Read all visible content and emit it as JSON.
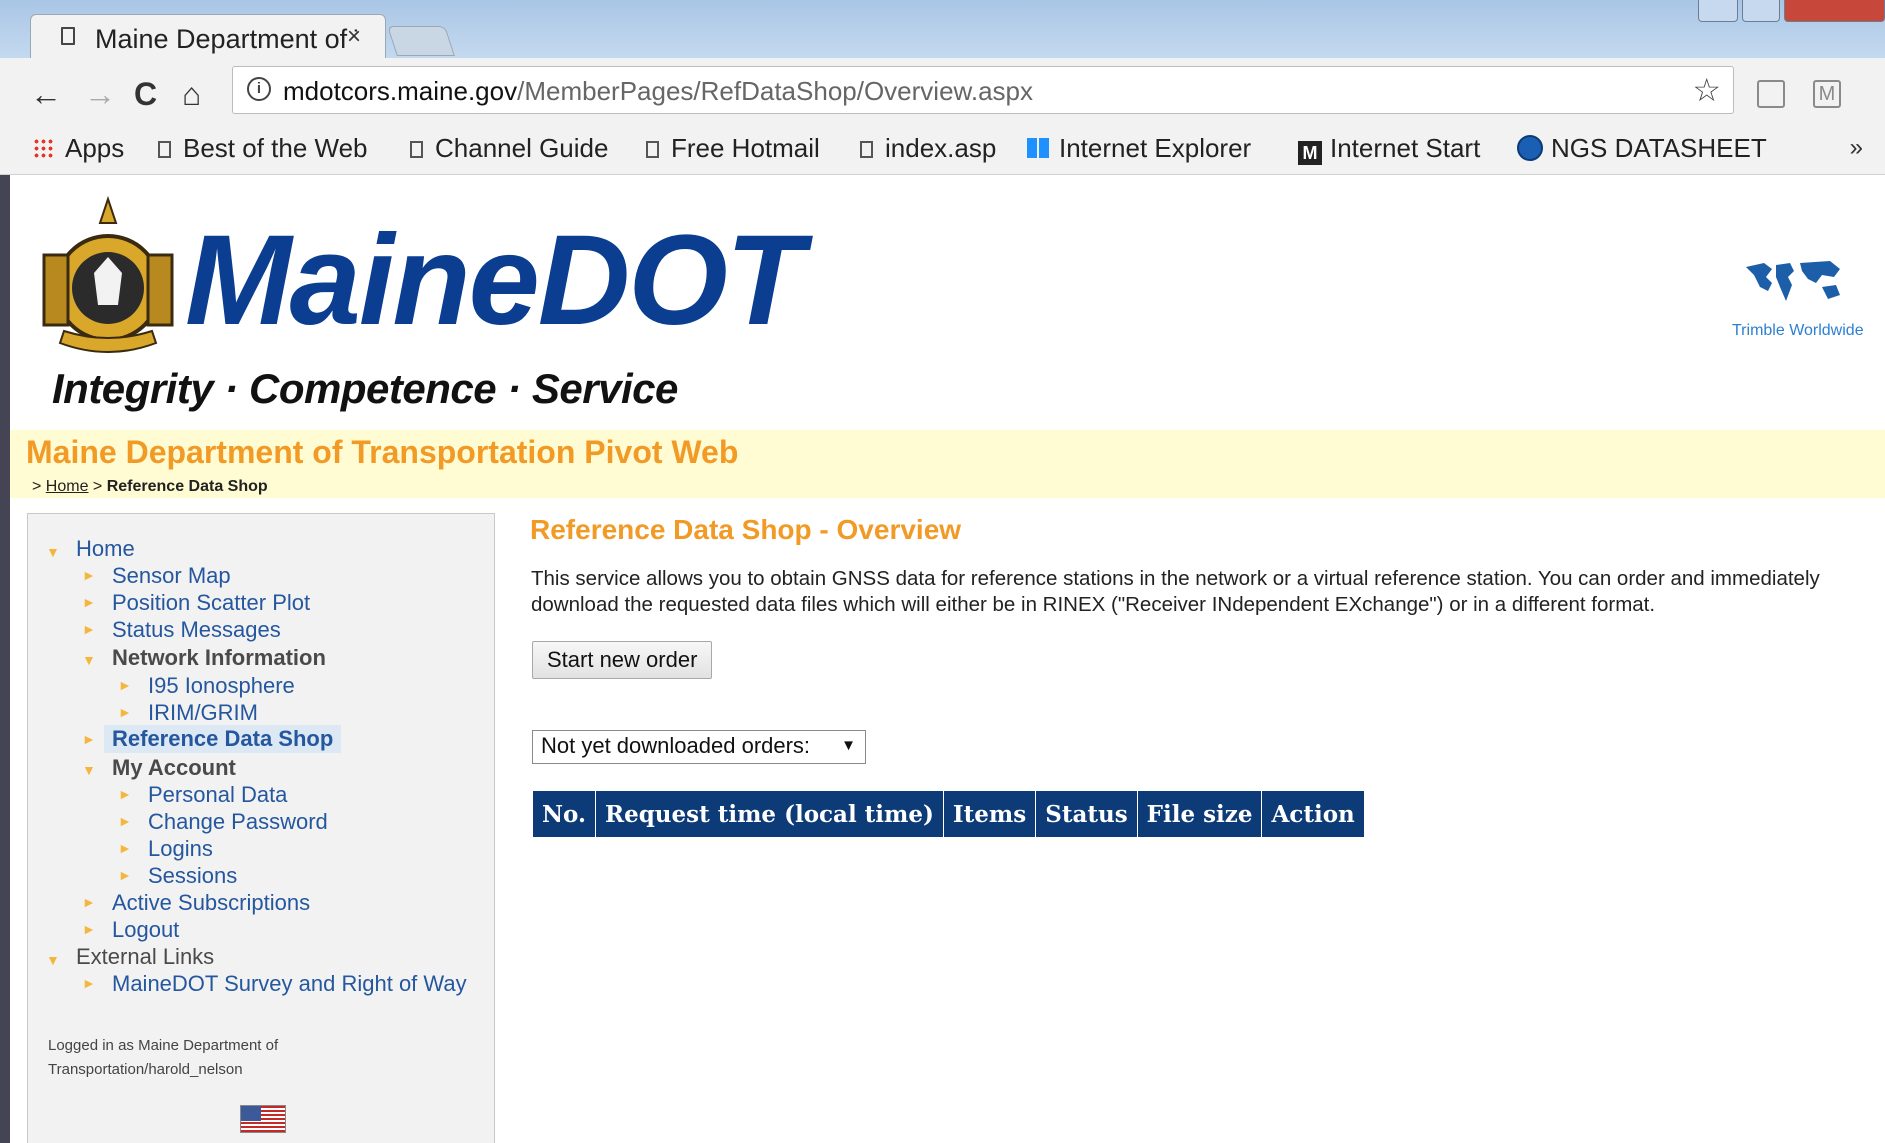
{
  "browser": {
    "tab_title": "Maine Department of Transportation",
    "tab_close": "×",
    "url_host": "mdotcors.maine.gov",
    "url_path": "/MemberPages/RefDataShop/Overview.aspx",
    "nav": {
      "back": "←",
      "forward": "→",
      "reload": "C",
      "home": "⌂",
      "star": "☆",
      "ext_m": "M",
      "info": "i"
    },
    "bookmarks": [
      {
        "label": "Apps"
      },
      {
        "label": "Best of the Web"
      },
      {
        "label": "Channel Guide"
      },
      {
        "label": "Free Hotmail"
      },
      {
        "label": "index.asp"
      },
      {
        "label": "Internet Explorer"
      },
      {
        "label": "Internet Start"
      },
      {
        "label": "NGS DATASHEET"
      }
    ],
    "bookmarks_more": "»",
    "msn_letter": "M"
  },
  "header": {
    "logo_text": "MaineDOT",
    "tagline": "Integrity · Competence · Service",
    "partner_caption": "Trimble Worldwide"
  },
  "site": {
    "title": "Maine Department of Transportation Pivot Web",
    "breadcrumb": {
      "prefix": "> ",
      "home": "Home",
      "separator": " > ",
      "current": "Reference Data Shop"
    }
  },
  "sidebar": {
    "items": [
      {
        "label": "Home"
      },
      {
        "label": "Sensor Map"
      },
      {
        "label": "Position Scatter Plot"
      },
      {
        "label": "Status Messages"
      },
      {
        "label": "Network Information"
      },
      {
        "label": "I95 Ionosphere"
      },
      {
        "label": "IRIM/GRIM"
      },
      {
        "label": "Reference Data Shop"
      },
      {
        "label": "My Account"
      },
      {
        "label": "Personal Data"
      },
      {
        "label": "Change Password"
      },
      {
        "label": "Logins"
      },
      {
        "label": "Sessions"
      },
      {
        "label": "Active Subscriptions"
      },
      {
        "label": "Logout"
      },
      {
        "label": "External Links"
      },
      {
        "label": "MaineDOT Survey and Right of Way"
      }
    ],
    "login_info": "Logged in as Maine Department of Transportation/harold_nelson"
  },
  "main": {
    "title": "Reference Data Shop - Overview",
    "description": "This service allows you to obtain GNSS data for reference stations in the network or a virtual reference station. You can order and immediately download the requested data files which will either be in RINEX (\"Receiver INdependent EXchange\") or in a different format.",
    "start_button": "Start new order",
    "order_filter": {
      "selected": "Not yet downloaded orders:",
      "arrow": "▼"
    },
    "table": {
      "columns": [
        "No.",
        "Request time (local time)",
        "Items",
        "Status",
        "File size",
        "Action"
      ]
    }
  },
  "colors": {
    "accent_orange": "#f29a26",
    "brand_blue": "#0b3d91",
    "table_header": "#0d3b78",
    "title_band": "#fffbd2"
  }
}
